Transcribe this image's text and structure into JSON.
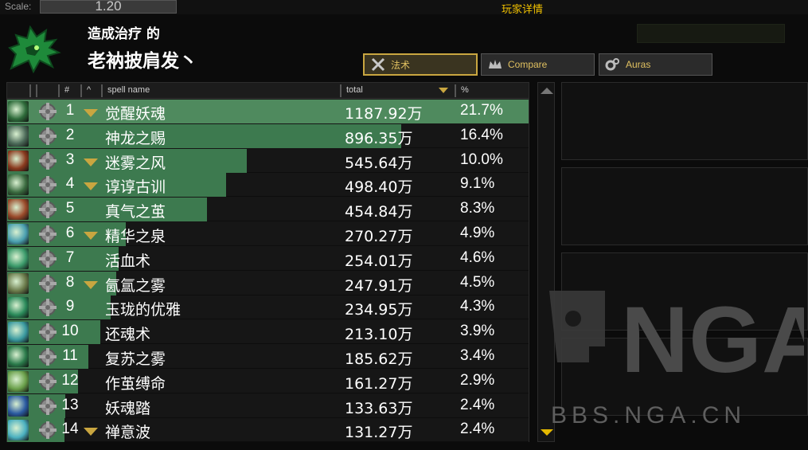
{
  "topbar": {
    "scale_label": "Scale:",
    "scale_value": "1.20",
    "window_title": "玩家详情"
  },
  "header": {
    "subtitle": "造成治疗 的",
    "player_name": "老衲披肩发丶"
  },
  "tabs": [
    {
      "label": "法术",
      "icon": "crossed-swords-icon",
      "active": true
    },
    {
      "label": "Compare",
      "icon": "crown-icon",
      "active": false
    },
    {
      "label": "Auras",
      "icon": "gears-icon",
      "active": false
    }
  ],
  "columns": {
    "rank": "#",
    "sort": "^",
    "spell_name": "spell name",
    "total": "total",
    "pct": "%"
  },
  "rows": [
    {
      "rank": "1",
      "name": "觉醒妖魂",
      "total": "1187.92万",
      "pct": "21.7%",
      "share": 1.0,
      "expandable": true,
      "icon_color": "#2e6b3a"
    },
    {
      "rank": "2",
      "name": "神龙之赐",
      "total": "896.35万",
      "pct": "16.4%",
      "share": 0.755,
      "expandable": false,
      "icon_color": "#4b6a58"
    },
    {
      "rank": "3",
      "name": "迷雾之风",
      "total": "545.64万",
      "pct": "10.0%",
      "share": 0.459,
      "expandable": true,
      "icon_color": "#8a3a1e"
    },
    {
      "rank": "4",
      "name": "谆谆古训",
      "total": "498.40万",
      "pct": "9.1%",
      "share": 0.42,
      "expandable": true,
      "icon_color": "#3a6b3f"
    },
    {
      "rank": "5",
      "name": "真气之茧",
      "total": "454.84万",
      "pct": "8.3%",
      "share": 0.383,
      "expandable": false,
      "icon_color": "#9a4a2a"
    },
    {
      "rank": "6",
      "name": "精华之泉",
      "total": "270.27万",
      "pct": "4.9%",
      "share": 0.228,
      "expandable": true,
      "icon_color": "#4aa0b0"
    },
    {
      "rank": "7",
      "name": "活血术",
      "total": "254.01万",
      "pct": "4.6%",
      "share": 0.214,
      "expandable": false,
      "icon_color": "#3a9a6a"
    },
    {
      "rank": "8",
      "name": "氤氲之雾",
      "total": "247.91万",
      "pct": "4.5%",
      "share": 0.209,
      "expandable": true,
      "icon_color": "#6a7a4a"
    },
    {
      "rank": "9",
      "name": "玉珑的优雅",
      "total": "234.95万",
      "pct": "4.3%",
      "share": 0.198,
      "expandable": false,
      "icon_color": "#2a8a5a"
    },
    {
      "rank": "10",
      "name": "还魂术",
      "total": "213.10万",
      "pct": "3.9%",
      "share": 0.179,
      "expandable": false,
      "icon_color": "#3a9aa0"
    },
    {
      "rank": "11",
      "name": "复苏之雾",
      "total": "185.62万",
      "pct": "3.4%",
      "share": 0.156,
      "expandable": false,
      "icon_color": "#2a7a4a"
    },
    {
      "rank": "12",
      "name": "作茧缚命",
      "total": "161.27万",
      "pct": "2.9%",
      "share": 0.136,
      "expandable": false,
      "icon_color": "#6aa04a"
    },
    {
      "rank": "13",
      "name": "妖魂踏",
      "total": "133.63万",
      "pct": "2.4%",
      "share": 0.112,
      "expandable": false,
      "icon_color": "#2a5aa0"
    },
    {
      "rank": "14",
      "name": "禅意波",
      "total": "131.27万",
      "pct": "2.4%",
      "share": 0.11,
      "expandable": true,
      "icon_color": "#4ab0c0"
    }
  ],
  "watermark": {
    "text": "NGA",
    "url": "BBS.NGA.CN"
  },
  "colors": {
    "bar": "#3d7a4f",
    "accent": "#c9a640",
    "title": "#f2c200"
  }
}
